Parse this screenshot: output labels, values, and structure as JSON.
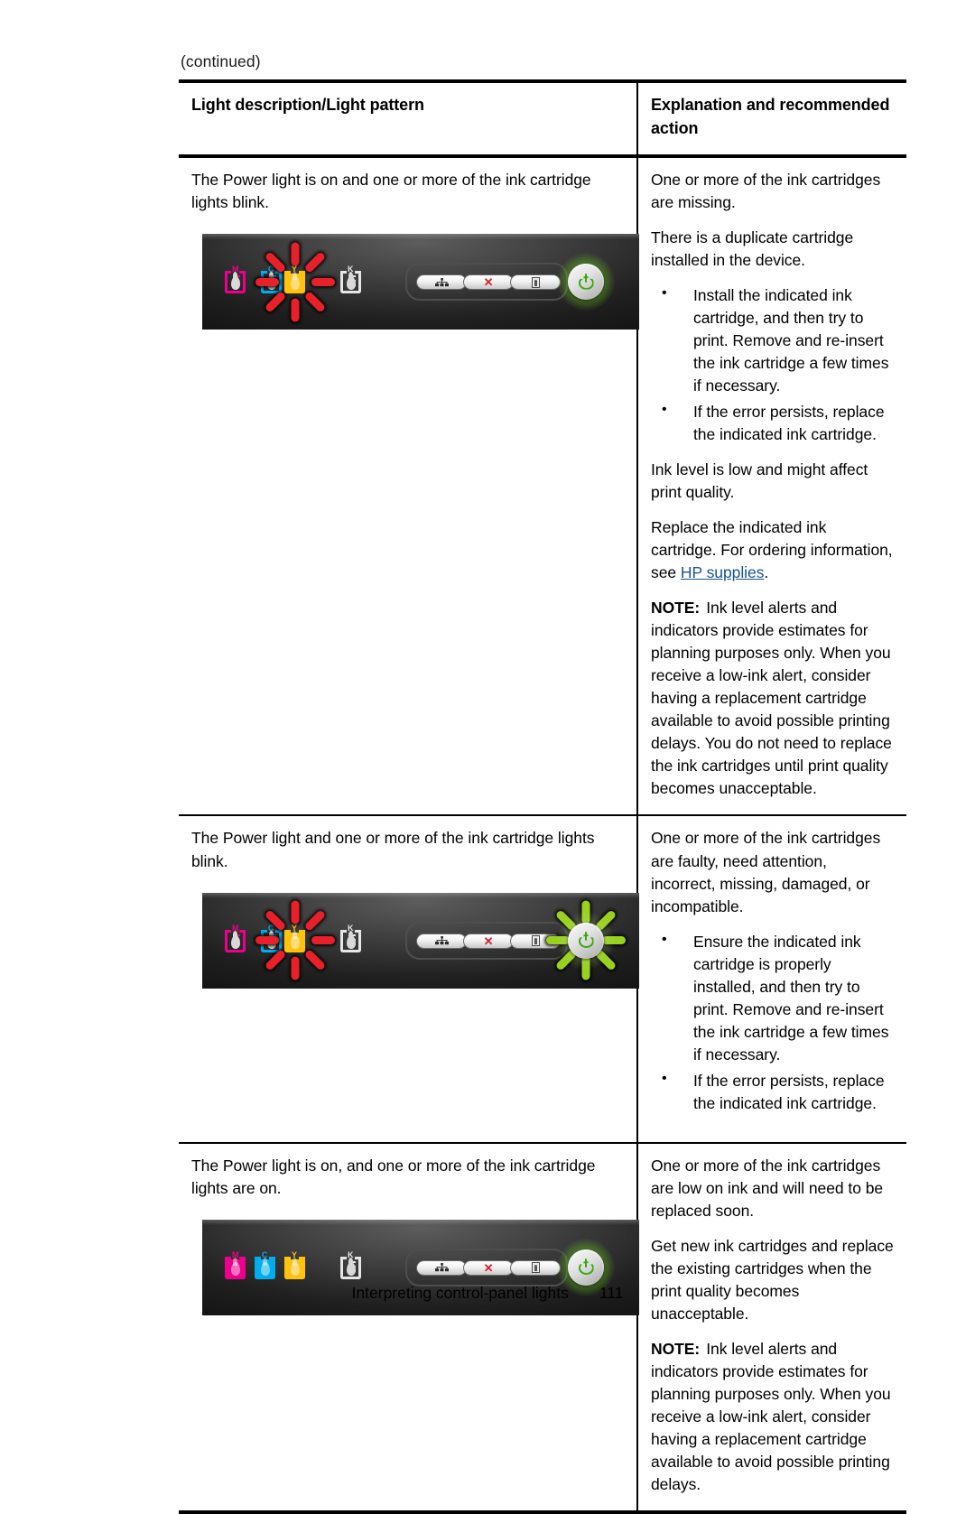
{
  "page": {
    "continued_label": "(continued)",
    "footer_title": "Interpreting control-panel lights",
    "footer_page_number": "111"
  },
  "table": {
    "headers": {
      "col1": "Light description/Light pattern",
      "col2": "Explanation and recommended action"
    },
    "rows": [
      {
        "description": "The Power light is on and one or more of the ink cartridge lights blink.",
        "panel": {
          "cartridges": [
            {
              "letter": "M",
              "color": "#ec008c",
              "state": "on"
            },
            {
              "letter": "C",
              "color": "#00aeef",
              "state": "on"
            },
            {
              "letter": "Y",
              "color": "#ffc20e",
              "state": "blink-red"
            },
            {
              "letter": "K",
              "color": "#e6e6e6",
              "state": "on"
            }
          ],
          "buttons": [
            {
              "name": "network-button",
              "icon": "network-icon"
            },
            {
              "name": "cancel-button",
              "icon": "x-icon",
              "icon_glyph": "✕"
            },
            {
              "name": "resume-button",
              "icon": "page-icon"
            }
          ],
          "power_light": {
            "state": "on",
            "color": "#7cd320"
          }
        },
        "explanation": {
          "paragraphs": [
            "One or more of the ink cartridges are missing.",
            "There is a duplicate cartridge installed in the device."
          ],
          "bullets": [
            "Install the indicated ink cartridge, and then try to print. Remove and re-insert the ink cartridge a few times if necessary.",
            "If the error persists, replace the indicated ink cartridge."
          ],
          "paragraphs_after": [
            "Ink level is low and might affect print quality."
          ],
          "replace_text_before": "Replace the indicated ink cartridge. For ordering information, see ",
          "replace_link": "HP supplies",
          "replace_text_after": ".",
          "note_label": "NOTE:",
          "note_text": "Ink level alerts and indicators provide estimates for planning purposes only. When you receive a low-ink alert, consider having a replacement cartridge available to avoid possible printing delays. You do not need to replace the ink cartridges until print quality becomes unacceptable."
        }
      },
      {
        "description": "The Power light and one or more of the ink cartridge lights blink.",
        "panel": {
          "cartridges": [
            {
              "letter": "M",
              "color": "#ec008c",
              "state": "on"
            },
            {
              "letter": "C",
              "color": "#00aeef",
              "state": "on"
            },
            {
              "letter": "Y",
              "color": "#ffc20e",
              "state": "blink-red"
            },
            {
              "letter": "K",
              "color": "#e6e6e6",
              "state": "on"
            }
          ],
          "buttons": [
            {
              "name": "network-button",
              "icon": "network-icon"
            },
            {
              "name": "cancel-button",
              "icon": "x-icon",
              "icon_glyph": "✕"
            },
            {
              "name": "resume-button",
              "icon": "page-icon"
            }
          ],
          "power_light": {
            "state": "blink",
            "color": "#9ad11f"
          }
        },
        "explanation": {
          "paragraphs": [
            "One or more of the ink cartridges are faulty, need attention, incorrect, missing, damaged, or incompatible."
          ],
          "bullets": [
            "Ensure the indicated ink cartridge is properly installed, and then try to print. Remove and re-insert the ink cartridge a few times if necessary.",
            "If the error persists, replace the indicated ink cartridge."
          ]
        }
      },
      {
        "description": "The Power light is on, and one or more of the ink cartridge lights are on.",
        "panel": {
          "cartridges": [
            {
              "letter": "M",
              "color": "#ec008c",
              "state": "lit"
            },
            {
              "letter": "C",
              "color": "#00aeef",
              "state": "lit"
            },
            {
              "letter": "Y",
              "color": "#ffc20e",
              "state": "lit"
            },
            {
              "letter": "K",
              "color": "#e6e6e6",
              "state": "on"
            }
          ],
          "buttons": [
            {
              "name": "network-button",
              "icon": "network-icon"
            },
            {
              "name": "cancel-button",
              "icon": "x-icon",
              "icon_glyph": "✕"
            },
            {
              "name": "resume-button",
              "icon": "page-icon"
            }
          ],
          "power_light": {
            "state": "on",
            "color": "#7cd320"
          }
        },
        "explanation": {
          "paragraphs": [
            "One or more of the ink cartridges are low on ink and will need to be replaced soon.",
            "Get new ink cartridges and replace the existing cartridges when the print quality becomes unacceptable."
          ],
          "note_label": "NOTE:",
          "note_text": "Ink level alerts and indicators provide estimates for planning purposes only. When you receive a low-ink alert, consider having a replacement cartridge available to avoid possible printing delays."
        }
      }
    ]
  },
  "colors": {
    "link": "#1a5490",
    "ray_red": "#e8202a",
    "ray_green": "#9ad11f",
    "cancel_x": "#d8202a"
  }
}
